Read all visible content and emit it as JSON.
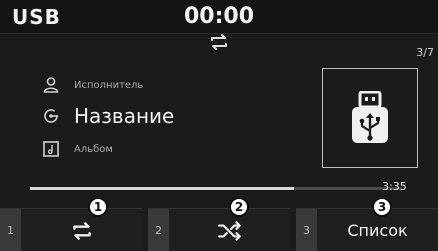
{
  "header": {
    "source": "USB",
    "time": "00:00",
    "mode_icon": "repeat-icon"
  },
  "track": {
    "counter": "3/7",
    "artist": "Исполнитель",
    "title": "Название",
    "album": "Альбом",
    "artist_icon": "person-icon",
    "title_icon": "song-title-icon",
    "album_icon": "album-icon",
    "cover_icon": "usb-icon",
    "duration": "3:35",
    "progress": 0.71
  },
  "softkeys": [
    {
      "num": "1",
      "icon": "repeat-icon",
      "callout": "1"
    },
    {
      "num": "2",
      "icon": "shuffle-icon",
      "callout": "2"
    },
    {
      "num": "3",
      "label": "Список",
      "callout": "3"
    }
  ],
  "colors": {
    "background": "#1b1b1b",
    "text": "#f2f2f2",
    "subtext": "#a9a9a9",
    "key_number": "#3a3a3a"
  }
}
